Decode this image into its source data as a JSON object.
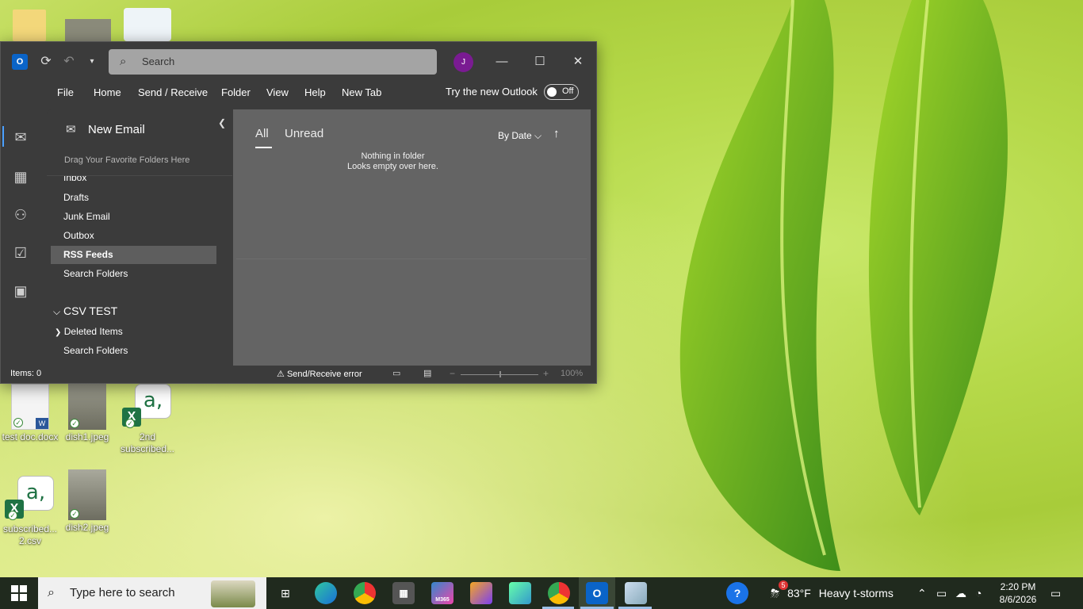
{
  "desktop": {
    "icons": [
      {
        "label": "test doc.docx"
      },
      {
        "label": "dish1.jpeg"
      },
      {
        "label": "2nd subscribed..."
      },
      {
        "label": "subscribed... 2.csv"
      },
      {
        "label": "dish2.jpeg"
      }
    ]
  },
  "outlook": {
    "search_placeholder": "Search",
    "avatar_initial": "J",
    "menu": [
      "File",
      "Home",
      "Send / Receive",
      "Folder",
      "View",
      "Help",
      "New Tab"
    ],
    "try_new_label": "Try the new Outlook",
    "toggle_label": "Off",
    "new_email_label": "New Email",
    "favorites_hint": "Drag Your Favorite Folders Here",
    "folders": [
      "Inbox",
      "Drafts",
      "Junk Email",
      "Outbox",
      "RSS Feeds",
      "Search Folders"
    ],
    "selected_folder": "RSS Feeds",
    "account": {
      "name": "CSV TEST",
      "folders": [
        "Deleted Items",
        "Search Folders"
      ]
    },
    "tabs": [
      "All",
      "Unread"
    ],
    "sort_label": "By Date",
    "empty_title": "Nothing in folder",
    "empty_subtitle": "Looks empty over here.",
    "status": {
      "items": "Items: 0",
      "error": "Send/Receive error",
      "zoom": "100%"
    }
  },
  "taskbar": {
    "search_placeholder": "Type here to search",
    "weather_temp": "83°F",
    "weather_desc": "Heavy t-storms",
    "weather_badge": "5",
    "time": "2:20 PM",
    "date": "8/6/2026",
    "m365_label": "M365"
  },
  "colors": {
    "window_bg": "#3b3b3b",
    "list_bg": "#646464",
    "avatar": "#7a1b92",
    "taskbar_bg": "#202a1e"
  }
}
